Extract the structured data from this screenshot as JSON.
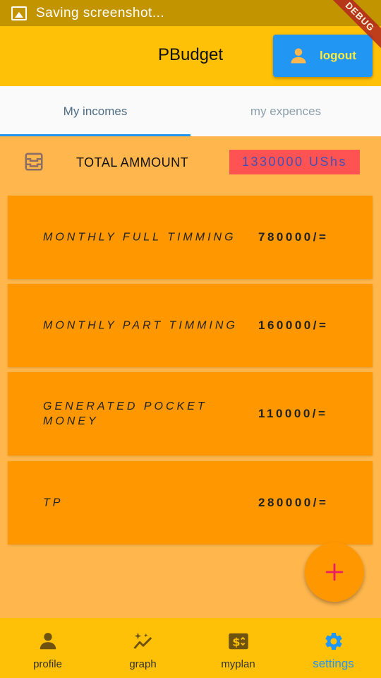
{
  "status_bar": {
    "text": "Saving screenshot...",
    "icon": "image-icon"
  },
  "debug_banner": "DEBUG",
  "app_bar": {
    "title": "PBudget",
    "logout_label": "logout"
  },
  "tabs": [
    {
      "label": "My incomes",
      "active": true
    },
    {
      "label": "my expences",
      "active": false
    }
  ],
  "total": {
    "label": "TOTAL AMMOUNT",
    "amount": "1330000 UShs"
  },
  "incomes": [
    {
      "name": "MONTHLY FULL TIMMING",
      "value": "780000/="
    },
    {
      "name": "MONTHLY PART TIMMING",
      "value": "160000/="
    },
    {
      "name": "GENERATED POCKET MONEY",
      "value": "110000/="
    },
    {
      "name": "TP",
      "value": "280000/="
    }
  ],
  "bottom_nav": [
    {
      "label": "profile",
      "icon": "person-icon",
      "active": false
    },
    {
      "label": "graph",
      "icon": "trending-icon",
      "active": false
    },
    {
      "label": "myplan",
      "icon": "money-icon",
      "active": false
    },
    {
      "label": "settings",
      "icon": "gear-icon",
      "active": true
    }
  ],
  "colors": {
    "status_bar": "#C29400",
    "app_bar": "#FFC107",
    "background": "#FFB74D",
    "card": "#FF9800",
    "accent_blue": "#2196F3",
    "total_badge": "#FF5252",
    "fab_plus": "#E91E63"
  }
}
